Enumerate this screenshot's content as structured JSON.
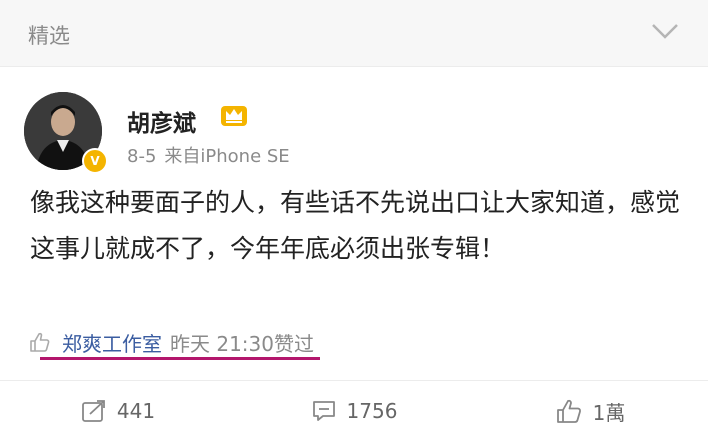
{
  "topbar": {
    "label": "精选",
    "chevron_icon": "chevron-down-icon"
  },
  "post": {
    "author": "胡彦斌",
    "date": "8-5",
    "source": "来自iPhone SE",
    "text": "像我这种要面子的人，有些话不先说出口让大家知道，感觉这事儿就成不了，今年年底必须出张专辑！",
    "liked_by": "郑爽工作室",
    "liked_time": "昨天 21:30赞过"
  },
  "actions": {
    "repost_count": "441",
    "comment_count": "1756",
    "like_count": "1萬"
  },
  "colors": {
    "underline": "#b3166c",
    "liked_by_link": "#3b5da1",
    "verified_badge": "#f4b400"
  }
}
